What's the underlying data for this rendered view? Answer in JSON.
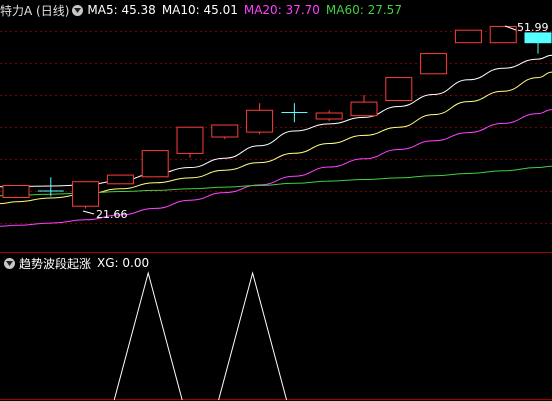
{
  "header": {
    "stock_title": "特力A (日线)",
    "ma5": "MA5: 45.38",
    "ma10": "MA10: 45.01",
    "ma20": "MA20: 37.70",
    "ma60": "MA60: 27.57"
  },
  "main_chart": {
    "high_label": "51.99",
    "low_label": "21.66",
    "colors": {
      "bullish": "#ff3c3c",
      "bearish": "#55ffff",
      "doji": "#55ffff",
      "ma5": "#ffffff",
      "ma10": "#ffff80",
      "ma20": "#ff40ff",
      "ma60": "#40d040",
      "grid": "#7a0000",
      "divider": "#a00000"
    }
  },
  "indicator": {
    "title": "趋势波段起涨",
    "xg": "XG: 0.00"
  },
  "chart_data": {
    "type": "candlestick",
    "candles": [
      {
        "open": 21.7,
        "close": 23.9,
        "high": 23.9,
        "low": 21.7
      },
      {
        "open": 22.9,
        "close": 22.9,
        "high": 25.4,
        "low": 21.9
      },
      {
        "open": 20.1,
        "close": 24.6,
        "high": 24.6,
        "low": 19.7
      },
      {
        "open": 24.2,
        "close": 25.8,
        "high": 25.8,
        "low": 24.2
      },
      {
        "open": 25.5,
        "close": 30.3,
        "high": 30.3,
        "low": 25.5
      },
      {
        "open": 29.8,
        "close": 34.6,
        "high": 34.6,
        "low": 29.0
      },
      {
        "open": 32.8,
        "close": 35.0,
        "high": 35.0,
        "low": 32.4
      },
      {
        "open": 33.7,
        "close": 37.7,
        "high": 39.0,
        "low": 33.3
      },
      {
        "open": 37.3,
        "close": 37.3,
        "high": 39.0,
        "low": 35.5
      },
      {
        "open": 36.1,
        "close": 37.2,
        "high": 37.7,
        "low": 35.7
      },
      {
        "open": 36.7,
        "close": 39.2,
        "high": 40.5,
        "low": 36.7
      },
      {
        "open": 39.5,
        "close": 43.7,
        "high": 43.7,
        "low": 39.5
      },
      {
        "open": 44.4,
        "close": 48.1,
        "high": 48.1,
        "low": 44.4
      },
      {
        "open": 50.1,
        "close": 52.4,
        "high": 52.4,
        "low": 50.1
      },
      {
        "open": 50.1,
        "close": 53.1,
        "high": 53.1,
        "low": 50.1
      },
      {
        "open": 51.9,
        "close": 50.1,
        "high": 51.9,
        "low": 48.1
      }
    ],
    "ma_series": [
      {
        "name": "MA5",
        "values": [
          23.7,
          23.8,
          24.0,
          24.8,
          26.1,
          27.2,
          28.9,
          31.2,
          33.9,
          35.2,
          36.4,
          38.4,
          40.6,
          43.3,
          45.4,
          47.1
        ]
      },
      {
        "name": "MA10",
        "values": [
          20.9,
          21.6,
          22.3,
          23.3,
          24.4,
          25.3,
          26.7,
          28.1,
          29.8,
          31.6,
          33.1,
          34.6,
          36.9,
          39.3,
          41.2,
          43.7
        ]
      },
      {
        "name": "MA20",
        "values": [
          16.6,
          17.0,
          17.6,
          18.5,
          19.7,
          21.2,
          22.6,
          24.0,
          25.6,
          27.3,
          28.8,
          30.5,
          32.1,
          33.6,
          35.3,
          37.1
        ]
      },
      {
        "name": "MA60",
        "values": [
          22.1,
          22.3,
          22.5,
          22.8,
          23.0,
          23.3,
          23.6,
          23.9,
          24.3,
          24.7,
          25.0,
          25.3,
          25.7,
          26.1,
          26.6,
          27.2
        ]
      }
    ],
    "indicator_values": [
      0,
      0,
      0,
      0,
      1,
      0,
      0,
      1,
      0,
      0,
      0,
      0,
      0,
      0,
      0,
      0
    ],
    "ylim": [
      15,
      55
    ]
  }
}
